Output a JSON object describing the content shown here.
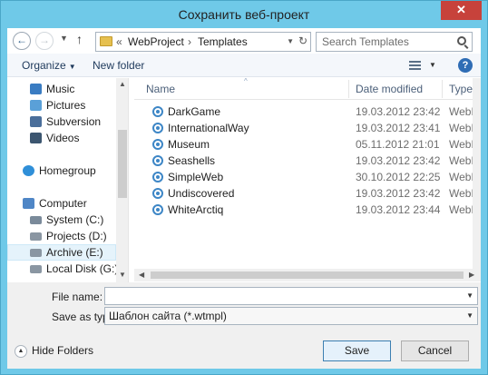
{
  "window": {
    "title": "Сохранить веб-проект",
    "close_label": "✕"
  },
  "nav": {
    "back_glyph": "←",
    "forward_glyph": "→",
    "recent_glyph": "▼",
    "up_glyph": "↑",
    "breadcrumb_sep": "«",
    "crumbs": [
      "WebProject",
      "Templates"
    ],
    "crumb_arrow": "›",
    "dropdown_glyph": "▼",
    "refresh_glyph": "↻",
    "search_placeholder": "Search Templates"
  },
  "toolbar": {
    "organize_label": "Organize",
    "organize_caret": "▼",
    "new_folder_label": "New folder",
    "views_caret": "▼",
    "help_glyph": "?"
  },
  "sidebar": {
    "items": [
      {
        "label": "Music",
        "icon": "music-icon",
        "color": "#3a7cc2"
      },
      {
        "label": "Pictures",
        "icon": "pictures-icon",
        "color": "#5aa0d8"
      },
      {
        "label": "Subversion",
        "icon": "subversion-icon",
        "color": "#4a6e9a"
      },
      {
        "label": "Videos",
        "icon": "videos-icon",
        "color": "#3c5670"
      },
      {
        "label": "Homegroup",
        "icon": "homegroup-icon",
        "color": "#2f8fd8"
      },
      {
        "label": "Computer",
        "icon": "computer-icon",
        "color": "#4f86c6"
      },
      {
        "label": "System (C:)",
        "icon": "drive-icon",
        "color": "#7a8a9a"
      },
      {
        "label": "Projects (D:)",
        "icon": "drive-icon",
        "color": "#8a96a2"
      },
      {
        "label": "Archive (E:)",
        "icon": "drive-icon",
        "color": "#8a96a2"
      },
      {
        "label": "Local Disk (G:)",
        "icon": "drive-icon",
        "color": "#8a96a2"
      }
    ],
    "selected": "Archive (E:)"
  },
  "files": {
    "columns": {
      "name": "Name",
      "date": "Date modified",
      "type": "Type",
      "sort_glyph": "^"
    },
    "rows": [
      {
        "name": "DarkGame",
        "date": "19.03.2012 23:42",
        "type": "WebProje"
      },
      {
        "name": "InternationalWay",
        "date": "19.03.2012 23:41",
        "type": "WebProje"
      },
      {
        "name": "Museum",
        "date": "05.11.2012 21:01",
        "type": "WebProje"
      },
      {
        "name": "Seashells",
        "date": "19.03.2012 23:42",
        "type": "WebProje"
      },
      {
        "name": "SimpleWeb",
        "date": "30.10.2012 22:25",
        "type": "WebProje"
      },
      {
        "name": "Undiscovered",
        "date": "19.03.2012 23:42",
        "type": "WebProje"
      },
      {
        "name": "WhiteArctiq",
        "date": "19.03.2012 23:44",
        "type": "WebProje"
      }
    ]
  },
  "form": {
    "file_name_label": "File name:",
    "file_name_value": "",
    "save_type_label": "Save as type:",
    "save_type_value": "Шаблон сайта (*.wtmpl)",
    "dropdown_glyph": "▼",
    "hide_folders_label": "Hide Folders",
    "hide_folders_glyph": "▲",
    "save_label": "Save",
    "cancel_label": "Cancel"
  },
  "scroll": {
    "up": "▲",
    "down": "▼",
    "left": "◀",
    "right": "▶"
  },
  "colors": {
    "titlebar": "#6fc9e8",
    "close": "#c7423b",
    "accent": "#3c7fb1",
    "selected_bg": "#e5f3fb"
  }
}
